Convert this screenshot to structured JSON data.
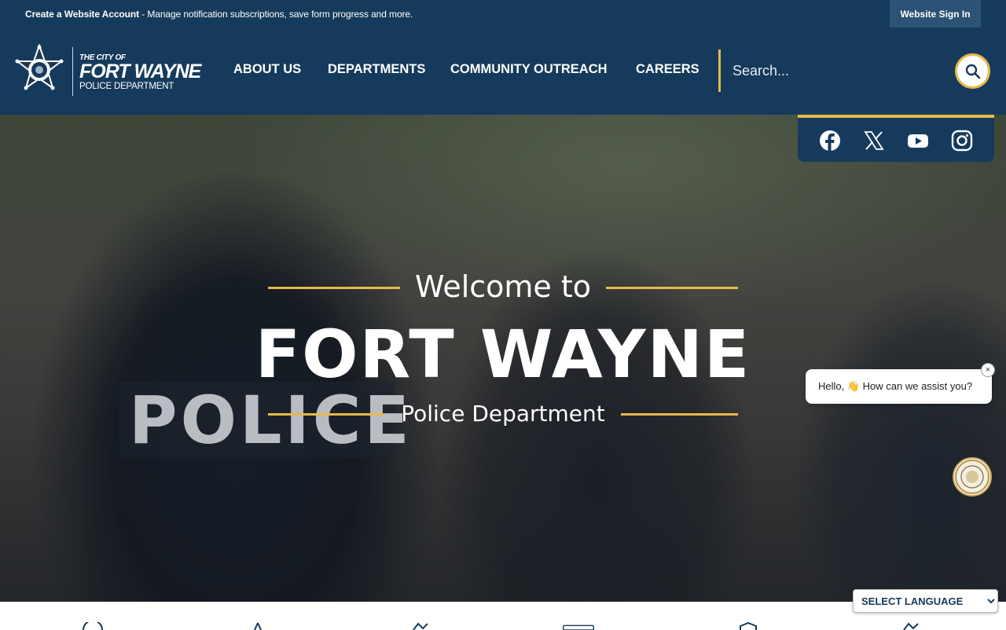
{
  "topbar": {
    "account_link": "Create a Website Account",
    "account_desc": " - Manage notification subscriptions, save form progress and more.",
    "signin_label": "Website Sign In"
  },
  "logo": {
    "city": "THE CITY OF",
    "name": "FORT WAYNE",
    "dept": "POLICE DEPARTMENT"
  },
  "nav": {
    "items": [
      {
        "label": "ABOUT US"
      },
      {
        "label": "DEPARTMENTS"
      },
      {
        "label": "COMMUNITY OUTREACH"
      },
      {
        "label": "CAREERS"
      }
    ]
  },
  "search": {
    "placeholder": "Search..."
  },
  "social": {
    "icons": [
      "facebook-icon",
      "x-icon",
      "youtube-icon",
      "instagram-icon"
    ]
  },
  "hero": {
    "welcome": "Welcome to",
    "title": "FORT WAYNE",
    "subtitle": "Police Department",
    "patch_text": "POLICE"
  },
  "chat": {
    "greeting": "Hello, 👋 How can we assist you?",
    "close": "×"
  },
  "language": {
    "selected": "SELECT LANGUAGE"
  },
  "colors": {
    "navy": "#163a5c",
    "gold": "#e8b84b"
  }
}
